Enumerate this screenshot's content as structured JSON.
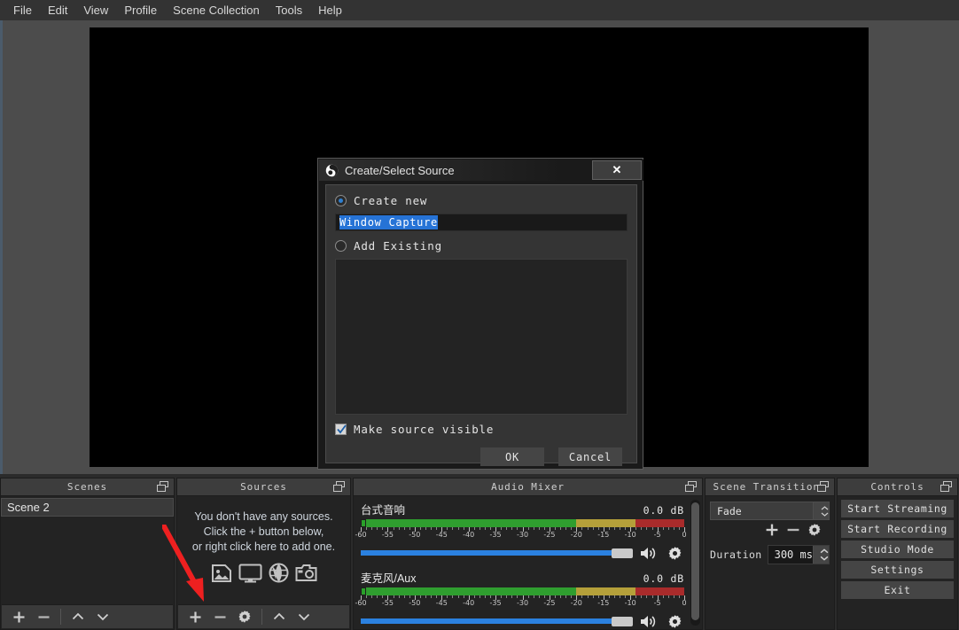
{
  "menubar": {
    "items": [
      {
        "label": "File"
      },
      {
        "label": "Edit"
      },
      {
        "label": "View"
      },
      {
        "label": "Profile"
      },
      {
        "label": "Scene Collection"
      },
      {
        "label": "Tools"
      },
      {
        "label": "Help"
      }
    ]
  },
  "dialog": {
    "title": "Create/Select Source",
    "logo_icon": "obs-logo-icon",
    "close_label": "✕",
    "create_new_label": "Create new",
    "create_new_selected": true,
    "source_name_value": "Window Capture",
    "source_name_selected": true,
    "add_existing_label": "Add Existing",
    "add_existing_selected": false,
    "existing_sources": [],
    "make_visible_label": "Make source visible",
    "make_visible_checked": true,
    "ok_label": "OK",
    "cancel_label": "Cancel"
  },
  "scenes": {
    "title": "Scenes",
    "items": [
      {
        "label": "Scene 2",
        "selected": true
      }
    ],
    "toolbar": [
      {
        "name": "add-scene-button",
        "icon": "plus-icon"
      },
      {
        "name": "remove-scene-button",
        "icon": "minus-icon"
      },
      {
        "name": "move-scene-up-button",
        "icon": "chevron-up-icon"
      },
      {
        "name": "move-scene-down-button",
        "icon": "chevron-down-icon"
      }
    ]
  },
  "sources": {
    "title": "Sources",
    "empty_line1": "You don't have any sources.",
    "empty_line2": "Click the + button below,",
    "empty_line3": "or right click here to add one.",
    "empty_icons": [
      "image-icon",
      "display-icon",
      "browser-globe-icon",
      "camera-icon"
    ],
    "toolbar": [
      {
        "name": "add-source-button",
        "icon": "plus-icon"
      },
      {
        "name": "remove-source-button",
        "icon": "minus-icon"
      },
      {
        "name": "source-properties-button",
        "icon": "gear-icon"
      },
      {
        "name": "move-source-up-button",
        "icon": "chevron-up-icon"
      },
      {
        "name": "move-source-down-button",
        "icon": "chevron-down-icon"
      }
    ]
  },
  "mixer": {
    "title": "Audio Mixer",
    "scale_labels": [
      "-60",
      "-55",
      "-50",
      "-45",
      "-40",
      "-35",
      "-30",
      "-25",
      "-20",
      "-15",
      "-10",
      "-5",
      "0"
    ],
    "channels": [
      {
        "name": "台式音响",
        "db": "0.0 dB",
        "volume_percent": 96,
        "mute_icon": "speaker-on-icon",
        "settings_icon": "gear-icon"
      },
      {
        "name": "麦克风/Aux",
        "db": "0.0 dB",
        "volume_percent": 96,
        "mute_icon": "speaker-on-icon",
        "settings_icon": "gear-icon"
      }
    ]
  },
  "transitions": {
    "title": "Scene Transitions",
    "selected_transition": "Fade",
    "add_icon": "plus-icon",
    "remove_icon": "minus-icon",
    "properties_icon": "gear-icon",
    "duration_label": "Duration",
    "duration_value": "300 ms"
  },
  "controls": {
    "title": "Controls",
    "buttons": [
      {
        "label": "Start Streaming"
      },
      {
        "label": "Start Recording"
      },
      {
        "label": "Studio Mode"
      },
      {
        "label": "Settings"
      },
      {
        "label": "Exit"
      }
    ]
  },
  "annotation": {
    "arrow_color": "#ee2020",
    "arrow_target": "add-source-button"
  },
  "colors": {
    "accent_blue": "#2673d6",
    "panel_bg": "#232323",
    "header_bg": "#3d3d3d",
    "meter_green": "#2f9e2f",
    "meter_yellow": "#b5a03a",
    "meter_red": "#a92b2b"
  }
}
